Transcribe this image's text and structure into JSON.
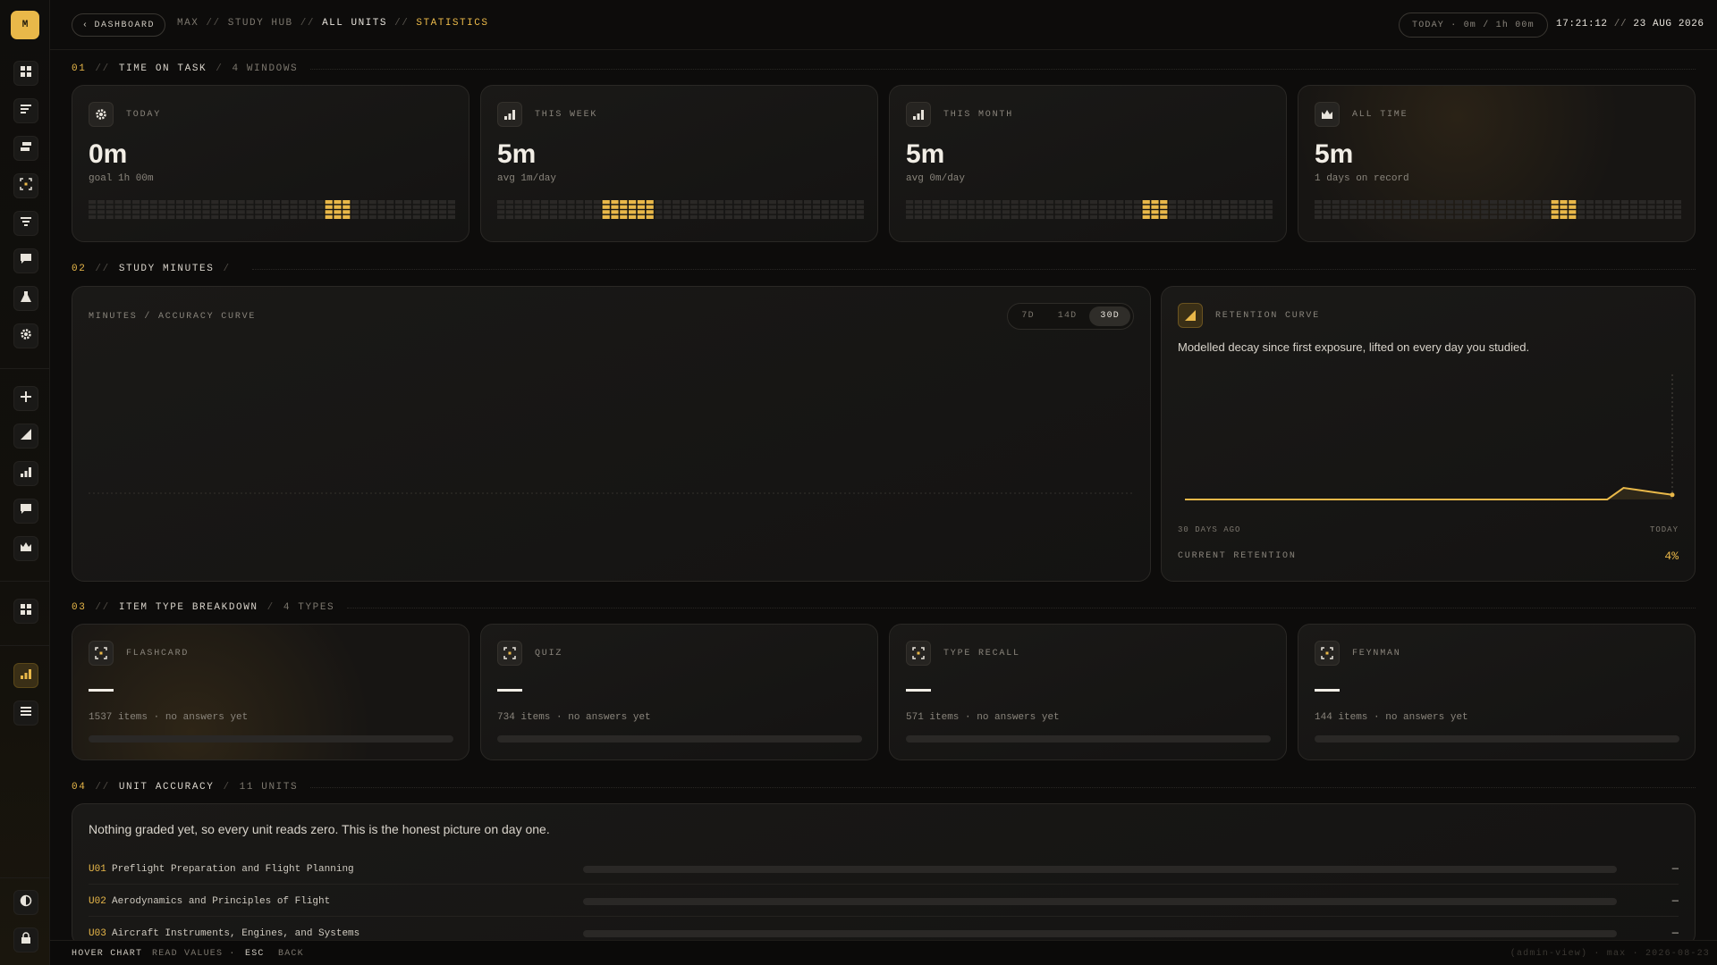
{
  "app": {
    "logo_letter": "M",
    "accent": "#e9b849",
    "background": "#0d0c0b"
  },
  "sidebar": {
    "items": [
      {
        "icon": "grid-icon"
      },
      {
        "icon": "list-lines-icon"
      },
      {
        "icon": "layers-icon"
      },
      {
        "icon": "focus-icon"
      },
      {
        "icon": "filter-lines-icon"
      },
      {
        "icon": "comment-icon"
      },
      {
        "icon": "flask-icon"
      },
      {
        "icon": "gear-icon"
      },
      {
        "icon": "plus-icon"
      },
      {
        "icon": "area-chart-icon"
      },
      {
        "icon": "bar-chart-icon"
      },
      {
        "icon": "comment-icon"
      },
      {
        "icon": "crown-icon"
      },
      {
        "icon": "grid-icon"
      },
      {
        "icon": "bar-chart-icon",
        "active": true
      },
      {
        "icon": "menu-icon"
      },
      {
        "icon": "contrast-icon"
      },
      {
        "icon": "lock-icon"
      }
    ]
  },
  "topbar": {
    "back_label": "DASHBOARD",
    "breadcrumb": [
      "MAX",
      "STUDY HUB",
      "ALL UNITS",
      "STATISTICS"
    ],
    "today_pill": "TODAY · 0m / 1h 00m",
    "time": "17:21:12",
    "date": "23 AUG 2026"
  },
  "sections": {
    "s1": {
      "num": "01",
      "title": "TIME ON TASK",
      "sub": "4 WINDOWS"
    },
    "s2": {
      "num": "02",
      "title": "STUDY MINUTES",
      "sub": ""
    },
    "s3": {
      "num": "03",
      "title": "ITEM TYPE BREAKDOWN",
      "sub": "4 TYPES"
    },
    "s4": {
      "num": "04",
      "title": "UNIT ACCURACY",
      "sub": "11 UNITS"
    }
  },
  "time_cards": [
    {
      "label": "TODAY",
      "value": "0m",
      "sub": "goal 1h 00m",
      "icon": "gear-icon",
      "highlight_start": 27,
      "highlight_count": 3
    },
    {
      "label": "THIS WEEK",
      "value": "5m",
      "sub": "avg 1m/day",
      "icon": "bar-chart-icon",
      "highlight_start": 12,
      "highlight_count": 6
    },
    {
      "label": "THIS MONTH",
      "value": "5m",
      "sub": "avg 0m/day",
      "icon": "bar-chart-icon",
      "highlight_start": 27,
      "highlight_count": 3
    },
    {
      "label": "ALL TIME",
      "value": "5m",
      "sub": "1 days on record",
      "icon": "crown-icon",
      "highlight_start": 27,
      "highlight_count": 3
    }
  ],
  "minutes_chart": {
    "label": "MINUTES / ACCURACY CURVE",
    "ranges": [
      "7D",
      "14D",
      "30D"
    ],
    "selected_range": "30D"
  },
  "retention": {
    "title": "RETENTION CURVE",
    "description": "Modelled decay since first exposure, lifted on every day you studied.",
    "x_start_label": "30 DAYS AGO",
    "x_end_label": "TODAY",
    "current_label": "CURRENT RETENTION",
    "current_value": "4%"
  },
  "chart_data": {
    "type": "line",
    "title": "RETENTION CURVE",
    "x": [
      "30 DAYS AGO",
      "TODAY"
    ],
    "series": [
      {
        "name": "",
        "values": [
          0,
          0,
          0,
          0,
          0,
          0,
          0,
          0,
          0,
          0,
          0,
          0,
          0,
          0,
          0,
          0,
          0,
          0,
          0,
          0,
          0,
          0,
          0,
          0,
          0,
          0,
          0,
          10,
          8,
          6,
          4
        ]
      }
    ],
    "ylim": [
      0,
      100
    ],
    "grid": false
  },
  "item_types": [
    {
      "name": "FLASHCARD",
      "value": "—",
      "items": "1537 items",
      "status": "no answers yet",
      "icon": "focus-icon"
    },
    {
      "name": "QUIZ",
      "value": "—",
      "items": "734 items",
      "status": "no answers yet",
      "icon": "focus-icon"
    },
    {
      "name": "TYPE RECALL",
      "value": "—",
      "items": "571 items",
      "status": "no answers yet",
      "icon": "focus-icon"
    },
    {
      "name": "FEYNMAN",
      "value": "—",
      "items": "144 items",
      "status": "no answers yet",
      "icon": "focus-icon"
    }
  ],
  "unit_accuracy": {
    "description": "Nothing graded yet, so every unit reads zero. This is the honest picture on day one.",
    "units": [
      {
        "code": "U01",
        "name": "Preflight Preparation and Flight Planning",
        "value": "—"
      },
      {
        "code": "U02",
        "name": "Aerodynamics and Principles of Flight",
        "value": "—"
      },
      {
        "code": "U03",
        "name": "Aircraft Instruments, Engines, and Systems",
        "value": "—"
      }
    ]
  },
  "footer": {
    "hint1_key": "HOVER CHART",
    "hint1_text": "READ VALUES ·",
    "hint2_key": "ESC",
    "hint2_text": "BACK",
    "right_text": "(admin-view) · max · 2026-08-23"
  }
}
